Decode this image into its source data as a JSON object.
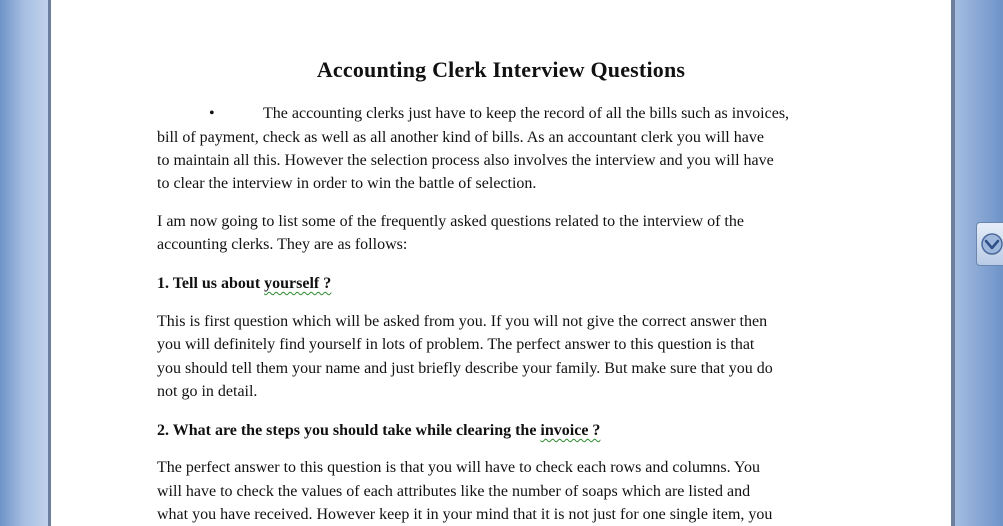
{
  "document": {
    "title": "Accounting Clerk Interview Questions",
    "bullet_symbol": "•",
    "intro_line1": "The accounting clerks just have to keep the record of all the bills such as invoices,",
    "intro_line2": "bill of payment, check as well as all another kind of bills. As an accountant clerk you will have",
    "intro_line3": "to maintain all this. However the selection process also involves the interview and you will have",
    "intro_line4": "to clear the interview in order to win the battle of selection.",
    "list_intro_line1": "I am now going to list some of the frequently asked questions related to the interview of the",
    "list_intro_line2": "accounting clerks. They are as follows:",
    "q1_prefix": "1. Tell us about ",
    "q1_word": "yourself ?",
    "a1_line1": "This is first question which will be asked from you. If you will not give the correct answer then",
    "a1_line2": "you will definitely find yourself in lots of problem. The perfect answer to this question is that",
    "a1_line3": "you should tell them your name and just briefly describe your family. But make sure that you do",
    "a1_line4": "not go in detail.",
    "q2_prefix": "2. What are the steps you should take while clearing the ",
    "q2_word": "invoice ?",
    "a2_line1": "The perfect answer to this question is that you will have to check each rows and columns. You",
    "a2_line2": "will have to check the values of each attributes like the number of soaps which are listed and",
    "a2_line3": "what you have received. However keep it in your mind that it is not just for one single item, you"
  },
  "icons": {
    "side_widget": "browse-object-icon"
  }
}
